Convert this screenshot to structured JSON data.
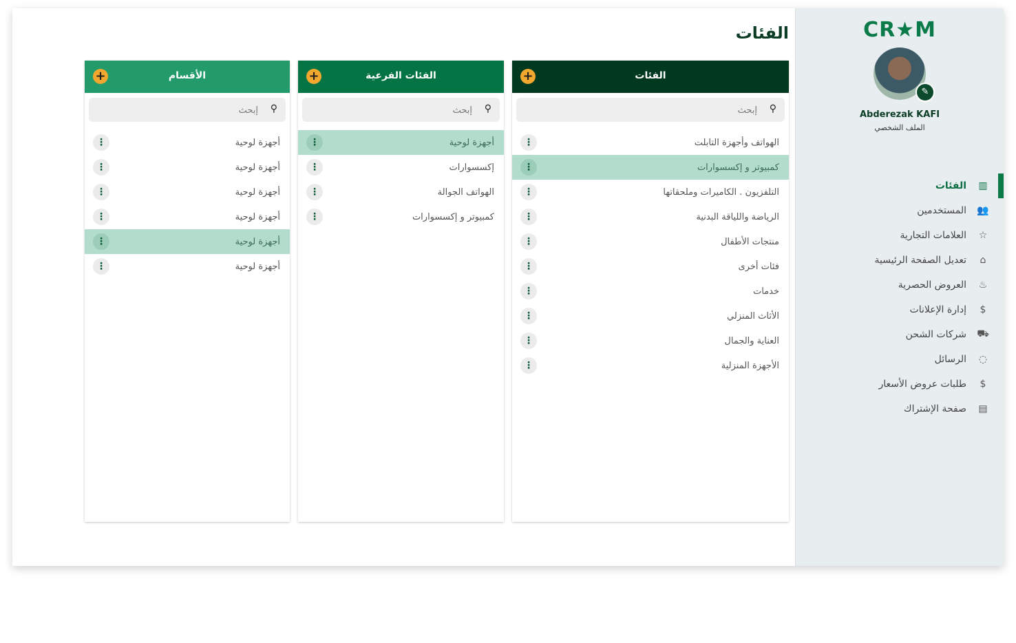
{
  "sidebar": {
    "logo": "CR★M",
    "user_name": "Abderezak KAFI",
    "user_role": "الملف الشخصي",
    "nav": [
      {
        "label": "الفئات",
        "icon": "columns-icon",
        "glyph": "▥",
        "active": true
      },
      {
        "label": "المستخدمين",
        "icon": "users-icon",
        "glyph": "👥",
        "active": false
      },
      {
        "label": "العلامات التجارية",
        "icon": "star-icon",
        "glyph": "☆",
        "active": false
      },
      {
        "label": "تعديل الصفحة الرئيسية",
        "icon": "home-icon",
        "glyph": "⌂",
        "active": false
      },
      {
        "label": "العروض الحصرية",
        "icon": "flame-icon",
        "glyph": "♨",
        "active": false
      },
      {
        "label": "إدارة الإعلانات",
        "icon": "dollar-icon",
        "glyph": "$",
        "active": false
      },
      {
        "label": "شركات الشحن",
        "icon": "truck-icon",
        "glyph": "⛟",
        "active": false
      },
      {
        "label": "الرسائل",
        "icon": "message-icon",
        "glyph": "◌",
        "active": false
      },
      {
        "label": "طلبات عروض الأسعار",
        "icon": "dollar-icon",
        "glyph": "$",
        "active": false
      },
      {
        "label": "صفحة الإشتراك",
        "icon": "document-icon",
        "glyph": "▤",
        "active": false
      }
    ]
  },
  "page_title": "الفئات",
  "colors": {
    "categories": "#00391f",
    "subcategories": "#047444",
    "sections": "#239a6a",
    "accent": "#f2a82e",
    "selected": "#b2dccb"
  },
  "panels": {
    "categories": {
      "title": "الفئات",
      "add_symbol": "+",
      "search_placeholder": "إبحث",
      "items": [
        "الهواتف وأجهزة التابلت",
        "كمبيوتر و إكسسوارات",
        "التلفزيون . الكاميرات وملحقاتها",
        "الرياضة واللياقة البدنية",
        "منتجات الأطفال",
        "فئات أخرى",
        "خدمات",
        "الأثاث المنزلي",
        "العناية والجمال",
        "الأجهزة المنزلية"
      ],
      "selected_index": 1
    },
    "subcategories": {
      "title": "الفئات الفرعية",
      "add_symbol": "+",
      "search_placeholder": "إبحث",
      "items": [
        "أجهزة لوحية",
        "إكسسوارات",
        "الهواتف الجوالة",
        "كمبيوتر و إكسسوارات"
      ],
      "selected_index": 0
    },
    "sections": {
      "title": "الأقسام",
      "add_symbol": "+",
      "search_placeholder": "إبحث",
      "items": [
        "أجهزة لوحية",
        "أجهزة لوحية",
        "أجهزة لوحية",
        "أجهزة لوحية",
        "أجهزة لوحية",
        "أجهزة لوحية"
      ],
      "selected_index": 4
    }
  }
}
